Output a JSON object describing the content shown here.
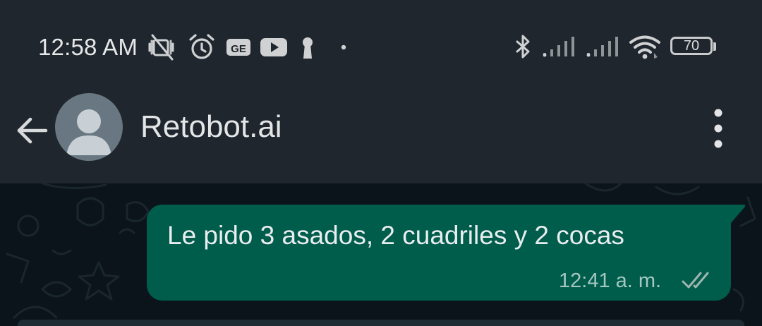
{
  "status_bar": {
    "time": "12:58 AM",
    "battery_level": "70",
    "left_icons": [
      "vibrate-off-icon",
      "alarm-icon",
      "ge-app-icon",
      "youtube-icon",
      "keyhole-icon",
      "dot-icon"
    ],
    "right_icons": [
      "bluetooth-icon",
      "signal-sim1-icon",
      "signal-sim2-icon",
      "wifi-icon",
      "battery-icon"
    ]
  },
  "app_bar": {
    "contact_name": "Retobot.ai",
    "back_icon": "arrow-back-icon",
    "menu_icon": "more-vert-icon",
    "avatar_icon": "default-person-icon"
  },
  "messages": [
    {
      "direction": "outgoing",
      "text": "Le pido 3 asados, 2 cuadriles y 2 cocas",
      "time": "12:41 a. m.",
      "status": "read",
      "status_icon": "double-check-icon"
    }
  ],
  "colors": {
    "header_bg": "#1f262d",
    "chat_bg": "#0b141a",
    "outgoing_bubble": "#005c4b",
    "text_primary": "#e9edef",
    "time_text": "#a4c8c0"
  }
}
